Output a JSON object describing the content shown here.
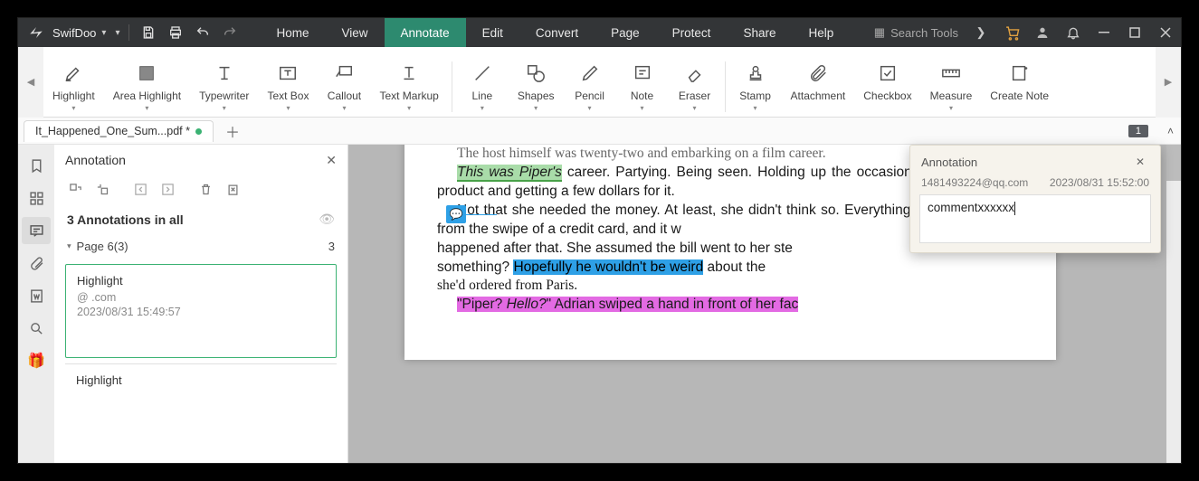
{
  "app_name": "SwifDoo",
  "menu": {
    "home": "Home",
    "view": "View",
    "annotate": "Annotate",
    "edit": "Edit",
    "convert": "Convert",
    "page": "Page",
    "protect": "Protect",
    "share": "Share",
    "help": "Help"
  },
  "search_placeholder": "Search Tools",
  "ribbon": {
    "highlight": "Highlight",
    "area_highlight": "Area Highlight",
    "typewriter": "Typewriter",
    "text_box": "Text Box",
    "callout": "Callout",
    "text_markup": "Text Markup",
    "line": "Line",
    "shapes": "Shapes",
    "pencil": "Pencil",
    "note": "Note",
    "eraser": "Eraser",
    "stamp": "Stamp",
    "attachment": "Attachment",
    "checkbox": "Checkbox",
    "measure": "Measure",
    "create_note": "Create Note"
  },
  "doc_tab": "It_Happened_One_Sum...pdf *",
  "page_badge": "1",
  "panel": {
    "title": "Annotation",
    "count_label": "3 Annotations in all",
    "page_group": "Page 6(3)",
    "page_count": "3",
    "card1_type": "Highlight",
    "card1_user": "                  @      .com",
    "card1_date": "2023/08/31 15:49:57",
    "card2_type": "Highlight"
  },
  "doc": {
    "line0": "The host himself was twenty-two and embarking on a film career.",
    "hl_green": "This was Piper's",
    "line1_rest": " career. Partying. Being seen. Holding up the occasional teeth-whitening product and getting a few dollars for it.",
    "line2_a": "Not that she needed the money. At least, she didn't think so. Everything she owned came from the swipe of a credit card, and it w",
    "line2_b": "happened after that. She assumed the bill went to her ste",
    "line2_c": "something? ",
    "hl_blue": "Hopefully he wouldn't be weird",
    "line2_d": " about the ",
    "line2_e": "she'd ordered from Paris.",
    "line3_a": "\"Piper? ",
    "line3_hello": "Hello?",
    "line3_b": "\" Adrian swiped a hand in front of her fac"
  },
  "popup": {
    "title": "Annotation",
    "user": "1481493224@qq.com",
    "date": "2023/08/31 15:52:00",
    "text": "commentxxxxxx"
  }
}
